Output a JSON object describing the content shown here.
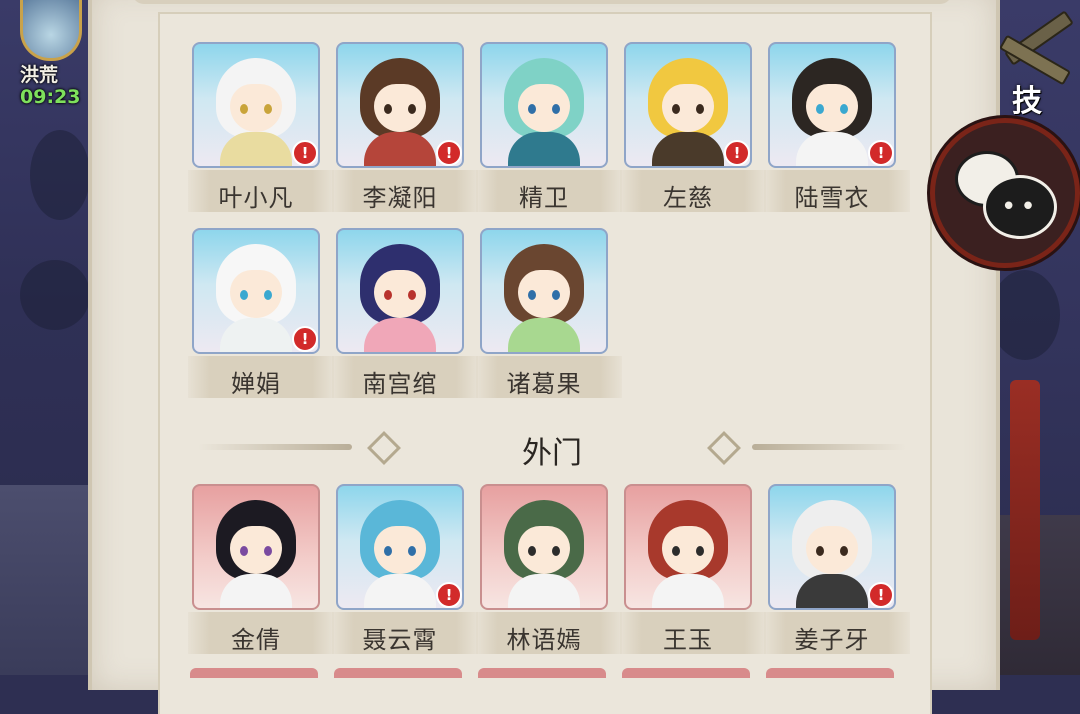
{
  "event": {
    "name": "洪荒",
    "timer": "09:23"
  },
  "skill_button": {
    "label": "技"
  },
  "section_divider": {
    "title": "外门"
  },
  "inner_disciples": [
    {
      "name": "叶小凡",
      "frame": "blue",
      "alert": true,
      "hair": "#f4f4f4",
      "body": "#e9dca0",
      "eye": "#c9a43a"
    },
    {
      "name": "李凝阳",
      "frame": "blue",
      "alert": true,
      "hair": "#5b3a26",
      "body": "#b5453a",
      "eye": "#3b2a1e"
    },
    {
      "name": "精卫",
      "frame": "blue",
      "alert": false,
      "hair": "#7fd2c6",
      "body": "#2f7a8e",
      "eye": "#2f6fa8"
    },
    {
      "name": "左慈",
      "frame": "blue",
      "alert": true,
      "hair": "#f1c840",
      "body": "#4a3a2a",
      "eye": "#3b2a1e"
    },
    {
      "name": "陆雪衣",
      "frame": "blue",
      "alert": true,
      "hair": "#2c2622",
      "body": "#f4f4f4",
      "eye": "#3aa8d0"
    },
    {
      "name": "婵娟",
      "frame": "blue",
      "alert": true,
      "hair": "#f7f7f7",
      "body": "#eef2f2",
      "eye": "#3aa8d0"
    },
    {
      "name": "南宫绾",
      "frame": "blue",
      "alert": false,
      "hair": "#2e2f6e",
      "body": "#f0a7b8",
      "eye": "#b8322c"
    },
    {
      "name": "诸葛果",
      "frame": "blue",
      "alert": false,
      "hair": "#6a4630",
      "body": "#a8d890",
      "eye": "#2f6fa8"
    }
  ],
  "outer_disciples": [
    {
      "name": "金倩",
      "frame": "red",
      "alert": false,
      "hair": "#1c1a22",
      "body": "#f4f4f4",
      "eye": "#7a4aa0"
    },
    {
      "name": "聂云霄",
      "frame": "blue",
      "alert": true,
      "hair": "#5ab7d8",
      "body": "#f4f4f4",
      "eye": "#2f6fa8"
    },
    {
      "name": "林语嫣",
      "frame": "red",
      "alert": false,
      "hair": "#4a6a48",
      "body": "#f4f4f4",
      "eye": "#2c2c2c"
    },
    {
      "name": "王玉",
      "frame": "red",
      "alert": false,
      "hair": "#a8392c",
      "body": "#f4f4f4",
      "eye": "#2c2c2c"
    },
    {
      "name": "姜子牙",
      "frame": "blue",
      "alert": true,
      "hair": "#eeeeee",
      "body": "#3a3a3a",
      "eye": "#3b2a1e"
    }
  ],
  "icons": [
    "chat-bubble-icon",
    "crossed-swords-icon",
    "alert-icon",
    "diamond-ornament-icon"
  ]
}
